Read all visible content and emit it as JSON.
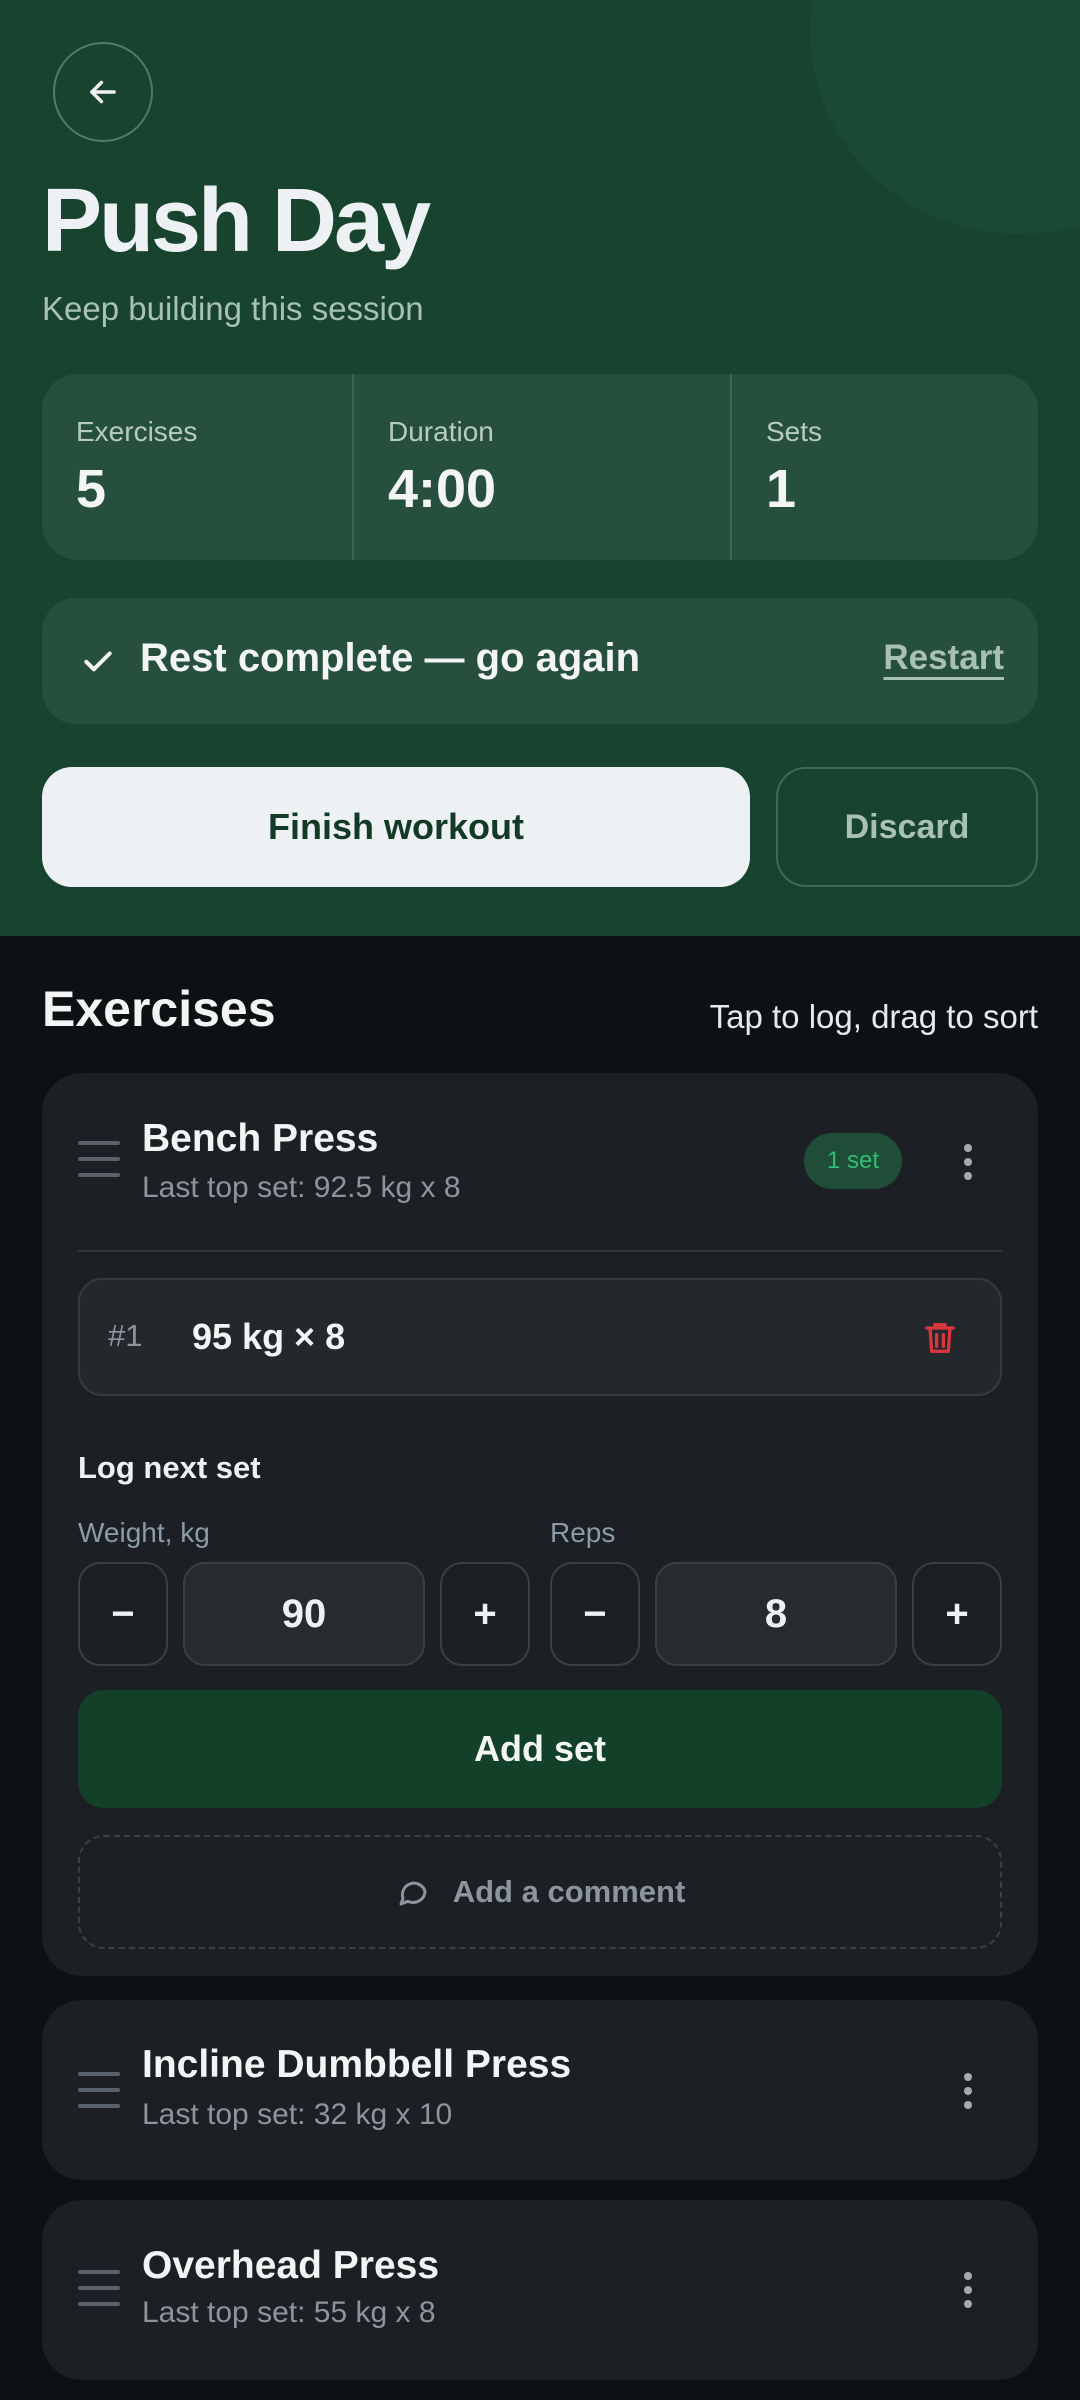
{
  "header": {
    "title": "Push Day",
    "subtitle": "Keep building this session",
    "stats": [
      {
        "label": "Exercises",
        "value": "5"
      },
      {
        "label": "Duration",
        "value": "4:00"
      },
      {
        "label": "Sets",
        "value": "1"
      }
    ],
    "rest_banner": {
      "text": "Rest complete — go again",
      "action": "Restart"
    },
    "finish_label": "Finish workout",
    "discard_label": "Discard"
  },
  "exercises_section": {
    "title": "Exercises",
    "hint": "Tap to log, drag to sort"
  },
  "exercises": [
    {
      "name": "Bench Press",
      "last": "Last top set: 92.5 kg x 8",
      "badge": "1 set",
      "sets": [
        {
          "num": "#1",
          "value": "95 kg × 8"
        }
      ],
      "log": {
        "title": "Log next set",
        "weight_label": "Weight, kg",
        "weight_value": "90",
        "reps_label": "Reps",
        "reps_value": "8",
        "minus": "−",
        "plus": "+",
        "add_label": "Add set",
        "comment_label": "Add a comment"
      }
    },
    {
      "name": "Incline Dumbbell Press",
      "last": "Last top set: 32 kg x 10"
    },
    {
      "name": "Overhead Press",
      "last": "Last top set: 55 kg x 8"
    }
  ],
  "colors": {
    "hero_bg": "#17432f",
    "page_bg": "#0e1114",
    "card_bg": "#1c2024",
    "accent_green": "#2fbf72",
    "danger_red": "#d9363e"
  },
  "icons": [
    "arrow-left-icon",
    "check-icon",
    "drag-handle-icon",
    "more-vertical-icon",
    "trash-icon",
    "comment-icon"
  ]
}
